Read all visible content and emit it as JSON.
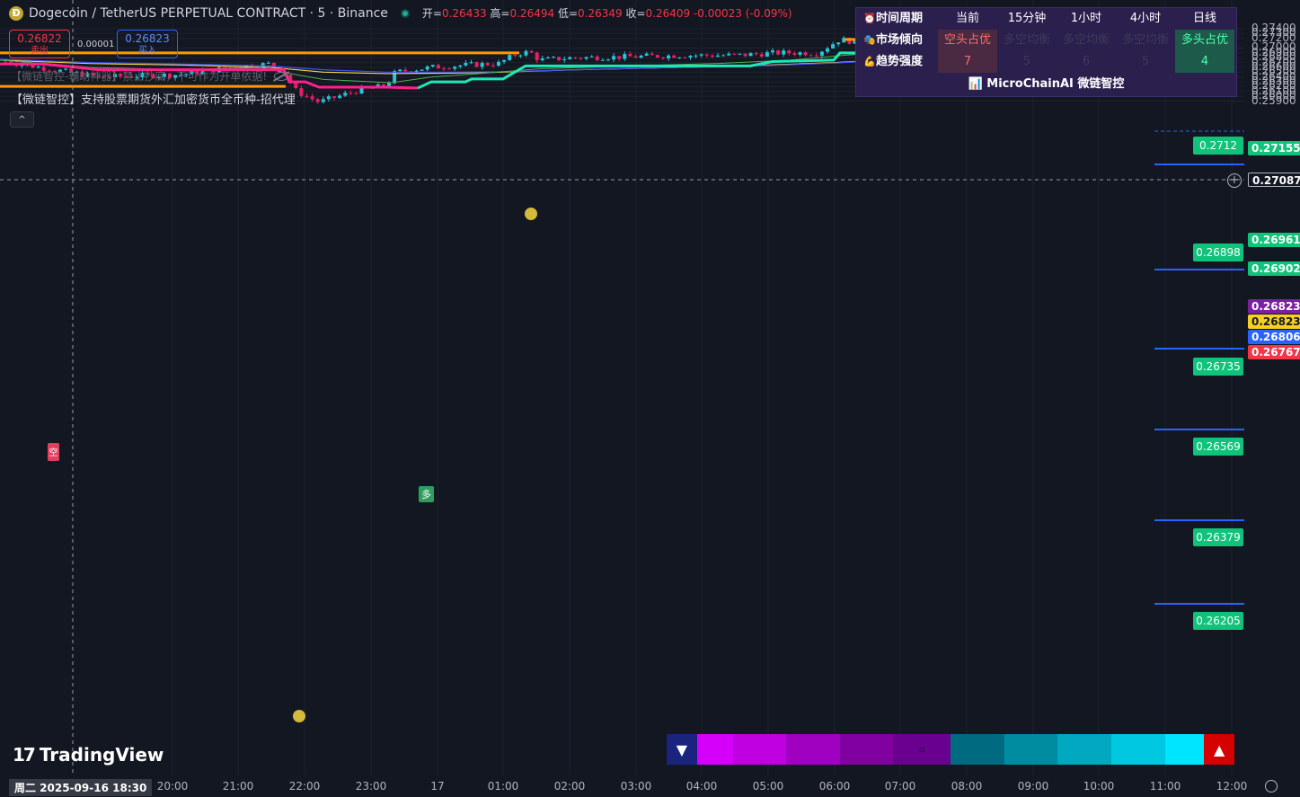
{
  "header": {
    "symbol": "Dogecoin / TetherUS PERPETUAL CONTRACT · 5 · Binance",
    "ohlc": {
      "open_label": "开=",
      "open": "0.26433",
      "high_label": "高=",
      "high": "0.26494",
      "low_label": "低=",
      "low": "0.26349",
      "close_label": "收=",
      "close": "0.26409",
      "change": "-0.00023 (-0.09%)"
    }
  },
  "trade": {
    "sell_price": "0.26822",
    "sell_label": "卖出",
    "spread": "0.00001",
    "buy_price": "0.26823",
    "buy_label": "买入"
  },
  "indicators": {
    "line1": "【微链智控-辅助神器】禁止抄底，不可作为开单依据!",
    "line2": "【微链智控】支持股票期货外汇加密货币全币种-招代理",
    "collapse": "^"
  },
  "info_table": {
    "headers": [
      "时间周期",
      "当前",
      "15分钟",
      "1小时",
      "4小时",
      "日线"
    ],
    "row1_label": "市场倾向",
    "row1": [
      "空头占优",
      "多空均衡",
      "多空均衡",
      "多空均衡",
      "多头占优"
    ],
    "row2_label": "趋势强度",
    "row2": [
      "7",
      "5",
      "6",
      "5",
      "4"
    ],
    "footer": "MicroChainAI 微链智控",
    "icons": {
      "clock": "alarm-clock-icon",
      "market": "theater-masks-icon",
      "strength": "muscle-icon",
      "chart": "bar-chart-icon"
    }
  },
  "price_scale": {
    "ticks": [
      "0.27400",
      "0.27300",
      "0.27200",
      "0.27000",
      "0.26900",
      "0.26800",
      "0.26700",
      "0.26600",
      "0.26500",
      "0.26400",
      "0.26300",
      "0.26200",
      "0.26100",
      "0.26000",
      "0.25900"
    ],
    "tags": [
      {
        "value": "0.27155",
        "color": "#10c37a"
      },
      {
        "value": "0.27087",
        "color": "#131722"
      },
      {
        "value": "0.26961",
        "color": "#10c37a"
      },
      {
        "value": "0.26902",
        "color": "#10c37a"
      },
      {
        "value": "0.26823",
        "color": "#7b1fa2"
      },
      {
        "value": "0.26823",
        "color": "#f5d020"
      },
      {
        "value": "0.26806",
        "color": "#2962ff"
      },
      {
        "value": "0.26767",
        "color": "#f23645"
      }
    ]
  },
  "levels": [
    "0.2712",
    "0.26898",
    "0.26735",
    "0.26569",
    "0.26379",
    "0.26205"
  ],
  "time_axis": {
    "date_label": "周二 2025-09-16   18:30",
    "ticks": [
      "20:00",
      "21:00",
      "22:00",
      "23:00",
      "17",
      "01:00",
      "02:00",
      "03:00",
      "04:00",
      "05:00",
      "06:00",
      "07:00",
      "08:00",
      "09:00",
      "10:00",
      "11:00",
      "12:00"
    ]
  },
  "logo": {
    "mark": "17",
    "text": "TradingView"
  },
  "signals": {
    "buy": "多",
    "sell": "空"
  },
  "colors": {
    "bg": "#131722",
    "up": "#26c6da",
    "down": "#e91e63",
    "st_up": "#1de9b6",
    "st_down": "#ff1f8e",
    "orange": "#ff9800",
    "ma_yellow": "#f5d547",
    "ma_blue": "#3f51f5",
    "ma_green": "#4caf50"
  }
}
